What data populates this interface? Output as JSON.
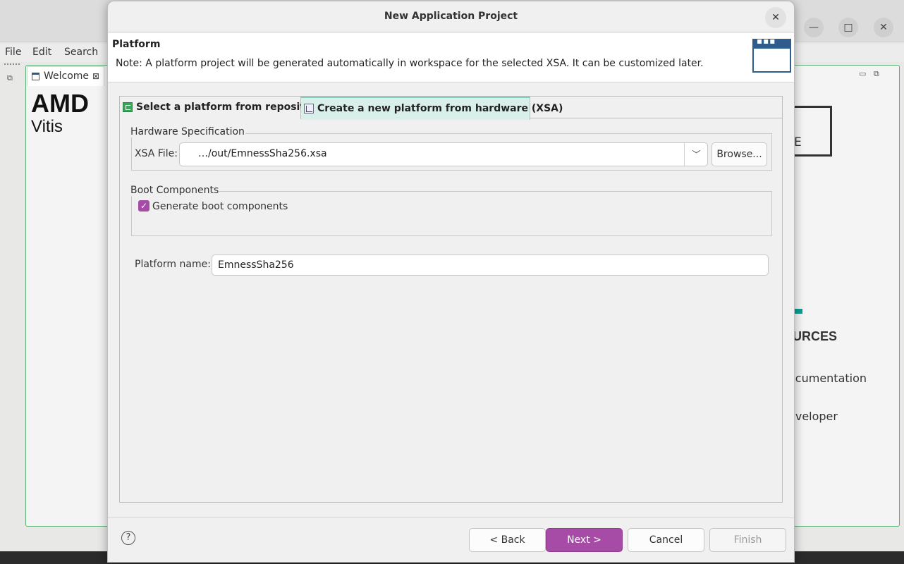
{
  "background_window": {
    "menu": [
      "File",
      "Edit",
      "Search"
    ],
    "tab_label": "Welcome",
    "brand": "AMD",
    "product": "Vitis",
    "box_letter": "E",
    "resources_heading": "OURCES",
    "links": [
      "ocumentation",
      "eveloper"
    ],
    "window_controls": {
      "minimize": "—",
      "maximize": "□",
      "close": "✕"
    }
  },
  "dialog": {
    "title": "New Application Project",
    "close_glyph": "✕",
    "header": {
      "title": "Platform",
      "note": "Note: A platform project will be generated automatically in workspace for the selected XSA. It can be customized later."
    },
    "tabs": [
      {
        "label": "Select a platform from repository",
        "selected": false
      },
      {
        "label": "Create a new platform from hardware (XSA)",
        "selected": true
      }
    ],
    "hardware_spec": {
      "group_title": "Hardware Specification",
      "xsa_label": "XSA File:",
      "xsa_value": "…/out/EmnessSha256.xsa",
      "browse_label": "Browse..."
    },
    "boot": {
      "group_title": "Boot Components",
      "checkbox_label": "Generate boot components",
      "checked": true
    },
    "platform_name": {
      "label": "Platform name:",
      "value": "EmnessSha256"
    },
    "footer": {
      "help_glyph": "?",
      "back_label": "< Back",
      "next_label": "Next >",
      "cancel_label": "Cancel",
      "finish_label": "Finish"
    }
  },
  "colors": {
    "accent_purple": "#a64ca6",
    "tab_selected": "#d9f0ea",
    "banner_blue": "#2d5c8d"
  }
}
